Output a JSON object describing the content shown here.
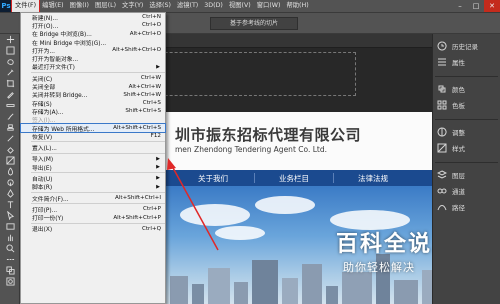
{
  "menubar": {
    "logo": "Ps",
    "items": [
      "文件(F)",
      "编辑(E)",
      "图像(I)",
      "图层(L)",
      "文字(Y)",
      "选择(S)",
      "滤镜(T)",
      "3D(D)",
      "视图(V)",
      "窗口(W)",
      "帮助(H)"
    ],
    "window_controls": [
      "–",
      "□",
      "✕"
    ]
  },
  "optionsbar": {
    "button_label": "基于参考线的切片"
  },
  "file_menu": {
    "rows": [
      {
        "label": "新建(N)...",
        "shortcut": "Ctrl+N"
      },
      {
        "label": "打开(O)...",
        "shortcut": "Ctrl+O"
      },
      {
        "label": "在 Bridge 中浏览(B)...",
        "shortcut": "Alt+Ctrl+O"
      },
      {
        "label": "在 Mini Bridge 中浏览(G)...",
        "shortcut": ""
      },
      {
        "label": "打开为...",
        "shortcut": "Alt+Shift+Ctrl+O"
      },
      {
        "label": "打开为智能对象...",
        "shortcut": ""
      },
      {
        "label": "最近打开文件(T)",
        "shortcut": "",
        "submenu": true
      },
      {
        "sep": true
      },
      {
        "label": "关闭(C)",
        "shortcut": "Ctrl+W"
      },
      {
        "label": "关闭全部",
        "shortcut": "Alt+Ctrl+W"
      },
      {
        "label": "关闭并转到 Bridge...",
        "shortcut": "Shift+Ctrl+W"
      },
      {
        "label": "存储(S)",
        "shortcut": "Ctrl+S"
      },
      {
        "label": "存储为(A)...",
        "shortcut": "Shift+Ctrl+S"
      },
      {
        "label": "签入(I)...",
        "shortcut": "",
        "disabled": true
      },
      {
        "label": "存储为 Web 所用格式...",
        "shortcut": "Alt+Shift+Ctrl+S",
        "highlight": true
      },
      {
        "label": "恢复(V)",
        "shortcut": "F12"
      },
      {
        "sep": true
      },
      {
        "label": "置入(L)...",
        "shortcut": ""
      },
      {
        "sep": true
      },
      {
        "label": "导入(M)",
        "shortcut": "",
        "submenu": true
      },
      {
        "label": "导出(E)",
        "shortcut": "",
        "submenu": true
      },
      {
        "sep": true
      },
      {
        "label": "自动(U)",
        "shortcut": "",
        "submenu": true
      },
      {
        "label": "脚本(R)",
        "shortcut": "",
        "submenu": true
      },
      {
        "sep": true
      },
      {
        "label": "文件简介(F)...",
        "shortcut": "Alt+Shift+Ctrl+I"
      },
      {
        "sep": true
      },
      {
        "label": "打印(P)...",
        "shortcut": "Ctrl+P"
      },
      {
        "label": "打印一份(Y)",
        "shortcut": "Alt+Shift+Ctrl+P"
      },
      {
        "sep": true
      },
      {
        "label": "退出(X)",
        "shortcut": "Ctrl+Q"
      }
    ]
  },
  "document": {
    "company_cn": "圳市振东招标代理有限公司",
    "company_en": "men Zhendong Tendering Agent Co. Ltd.",
    "nav": [
      "关于我们",
      "业务栏目",
      "法律法规"
    ]
  },
  "right_panel": {
    "group1": [
      {
        "icon": "history-icon",
        "label": "历史记录"
      },
      {
        "icon": "properties-icon",
        "label": "属性"
      }
    ],
    "group2": [
      {
        "icon": "color-icon",
        "label": "颜色"
      },
      {
        "icon": "swatches-icon",
        "label": "色板"
      }
    ],
    "group3": [
      {
        "icon": "adjustments-icon",
        "label": "调整"
      },
      {
        "icon": "styles-icon",
        "label": "样式"
      }
    ],
    "group4": [
      {
        "icon": "layers-icon",
        "label": "图层"
      },
      {
        "icon": "channels-icon",
        "label": "通道"
      },
      {
        "icon": "paths-icon",
        "label": "路径"
      }
    ]
  },
  "watermark": {
    "title": "百科全说",
    "subtitle": "助你轻松解决"
  }
}
